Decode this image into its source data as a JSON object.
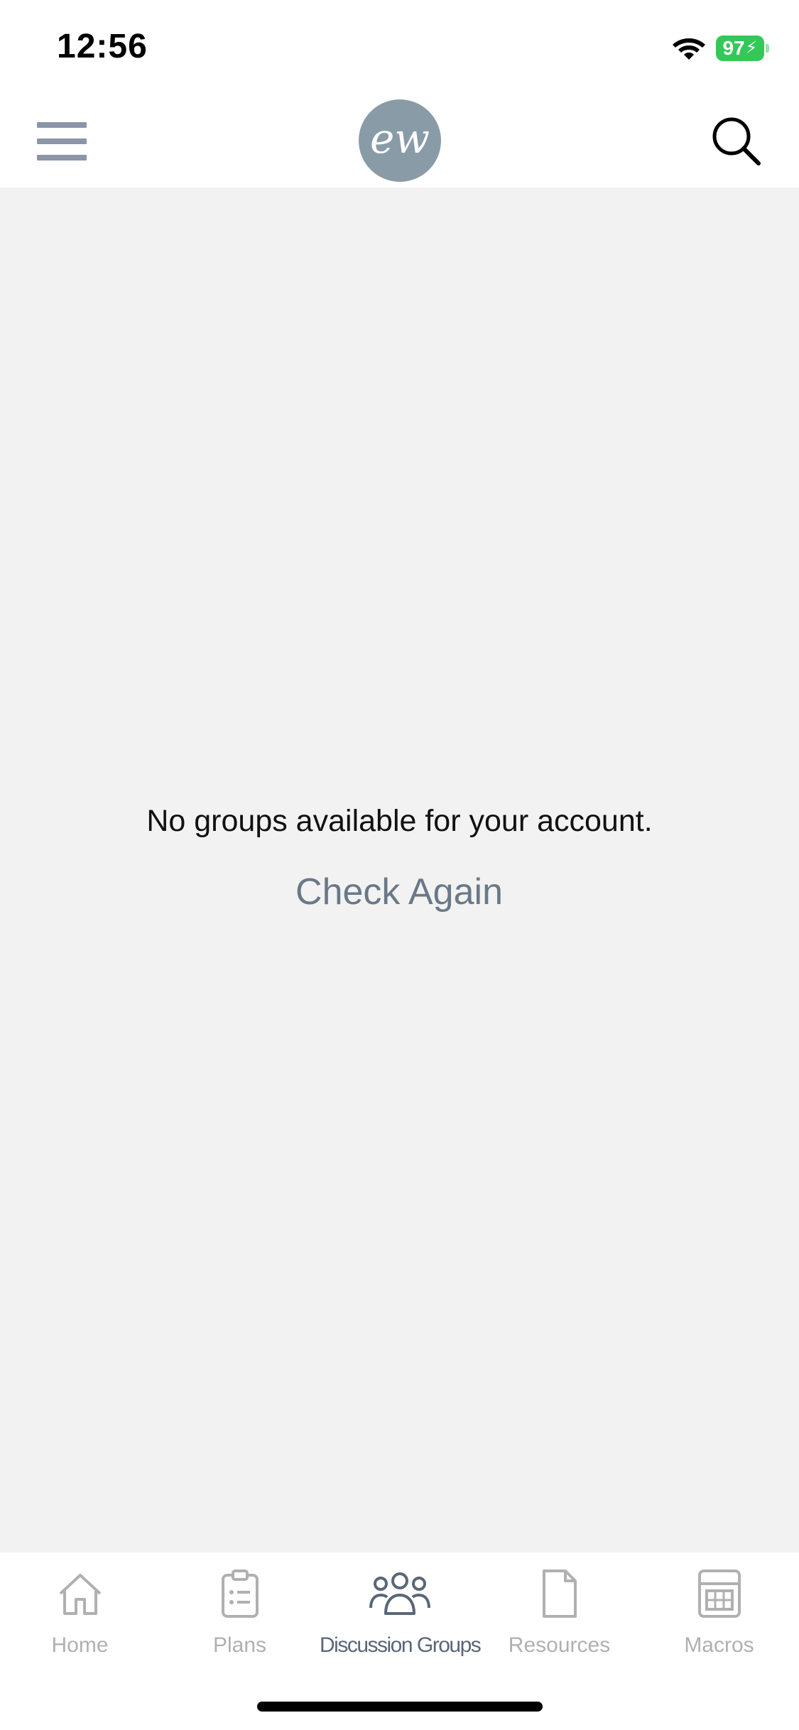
{
  "status_bar": {
    "time": "12:56",
    "battery_percent": "97"
  },
  "header": {
    "logo_text": "ew",
    "menu_icon": "hamburger-menu-icon",
    "search_icon": "search-icon",
    "logo_color": "#8a9ba8"
  },
  "main": {
    "empty_message": "No groups available for your account.",
    "check_again_label": "Check Again"
  },
  "tab_bar": {
    "tabs": [
      {
        "label": "Home",
        "icon": "home-icon",
        "active": false
      },
      {
        "label": "Plans",
        "icon": "clipboard-icon",
        "active": false
      },
      {
        "label": "Discussion Groups",
        "icon": "people-group-icon",
        "active": true
      },
      {
        "label": "Resources",
        "icon": "document-icon",
        "active": false
      },
      {
        "label": "Macros",
        "icon": "calculator-icon",
        "active": false
      }
    ]
  },
  "colors": {
    "active_tab": "#5a6678",
    "inactive_tab": "#b0b0b0",
    "link": "#6a7888",
    "background": "#f2f2f2",
    "battery": "#34c759"
  }
}
